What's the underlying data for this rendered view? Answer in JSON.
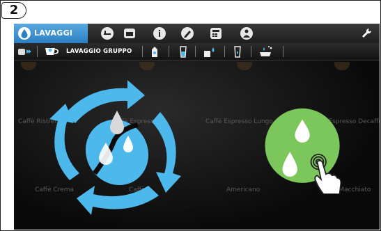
{
  "step": "2",
  "topbar": {
    "active_tab": "LAVAGGI",
    "icons": [
      "drop-icon",
      "bed-icon",
      "card-icon",
      "info-icon",
      "pencil-icon",
      "calculator-icon",
      "person-icon",
      "wrench-icon"
    ]
  },
  "subbar": {
    "active_label": "LAVAGGIO GRUPPO",
    "icons": [
      "cup-forward-icon",
      "cup-icon",
      "milk-carton-icon",
      "glass-icon",
      "hand-drop-icon",
      "glass-drop-icon",
      "tray-icon"
    ]
  },
  "background_products": {
    "row1": [
      "Caffè Ristretto",
      "Caffè Espresso",
      "Caffè Espresso Lungo",
      "Caffè Espresso Decaffeinato"
    ],
    "row2": [
      "Caffè Crema",
      "Caffè",
      "Americano",
      "Caffè Macchiato"
    ]
  },
  "colors": {
    "accent_blue": "#4db8ec",
    "green": "#7cc75b"
  }
}
